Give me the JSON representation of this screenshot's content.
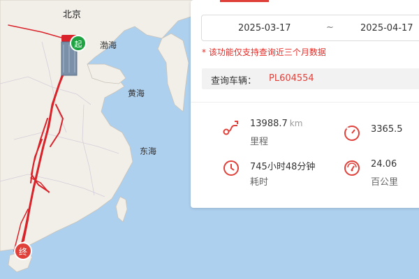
{
  "map": {
    "labels": {
      "beijing": "北京",
      "bohai": "渤海",
      "huanghai": "黄海",
      "donghai": "东海"
    },
    "markers": {
      "start": "起",
      "end": "终"
    },
    "colors": {
      "route": "#d8232a",
      "land": "#f2efe9",
      "sea": "#aed0ef",
      "vehicle": "#d8232a",
      "start_marker": "#1fa342",
      "end_marker": "#e0403a"
    }
  },
  "panel": {
    "date_range": {
      "start": "2025-03-17",
      "separator": "~",
      "end": "2025-04-17"
    },
    "notice": "* 该功能仅支持查询近三个月数据",
    "vehicle": {
      "label": "查询车辆：",
      "plate": "PL604554"
    },
    "stats": {
      "distance": {
        "value": "13988.7",
        "unit": "km",
        "label": "里程",
        "icon": "route-icon"
      },
      "speed": {
        "value": "3365.5",
        "icon": "speedometer-icon"
      },
      "duration": {
        "value": "745小时48分钟",
        "label": "耗时",
        "icon": "clock-icon"
      },
      "fuel": {
        "value": "24.06",
        "label": "百公里",
        "icon": "gauge-icon"
      }
    }
  }
}
